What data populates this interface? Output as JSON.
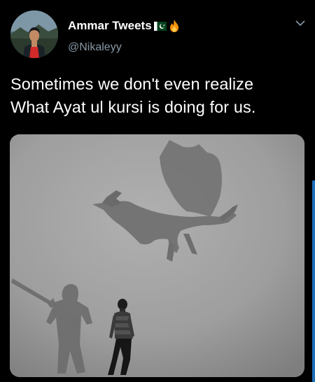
{
  "tweet": {
    "display_name": "Ammar Tweets",
    "handle": "@Nikaleyy",
    "text_lines": [
      "Sometimes we don't even realize",
      "What Ayat ul kursi is doing for us."
    ],
    "name_emoji_icons": [
      "pakistan-flag-icon",
      "fire-icon"
    ],
    "menu_icon": "chevron-down-icon",
    "media_description_icon": "photo"
  },
  "colors": {
    "background": "#000000",
    "text": "#ffffff",
    "handle": "#8899a6",
    "accent_scroll": "#1d6fb8"
  }
}
